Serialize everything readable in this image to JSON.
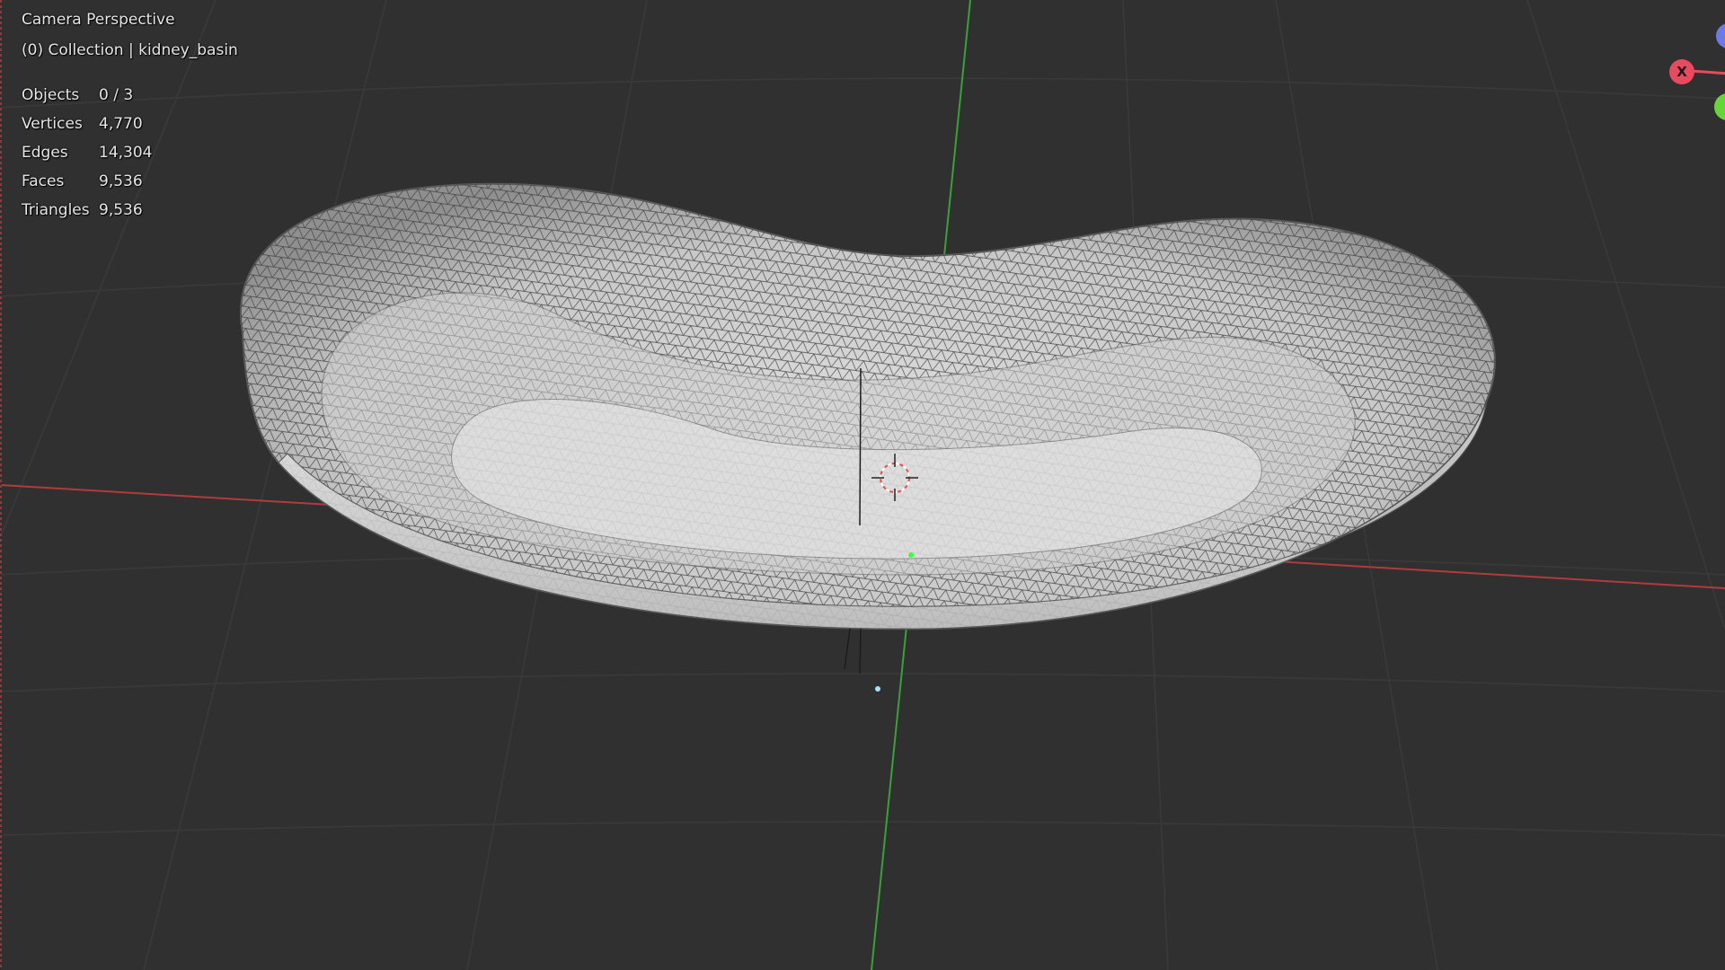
{
  "viewport": {
    "view_name": "Camera Perspective",
    "collection": "(0) Collection | kidney_basin"
  },
  "stats": [
    {
      "label": "Objects",
      "value": "0 / 3"
    },
    {
      "label": "Vertices",
      "value": "4,770"
    },
    {
      "label": "Edges",
      "value": "14,304"
    },
    {
      "label": "Faces",
      "value": "9,536"
    },
    {
      "label": "Triangles",
      "value": "9,536"
    }
  ],
  "gizmo": {
    "x_label": "X",
    "x_color": "#e84a5f",
    "y_color": "#65d53a",
    "z_color": "#6b7ae6"
  },
  "scene": {
    "object": "kidney_basin",
    "mesh_color": "#d9d9d9",
    "wire_color": "#404040",
    "background": "#303030",
    "x_axis_color": "#b33a3a",
    "y_axis_color": "#3aa13a"
  }
}
